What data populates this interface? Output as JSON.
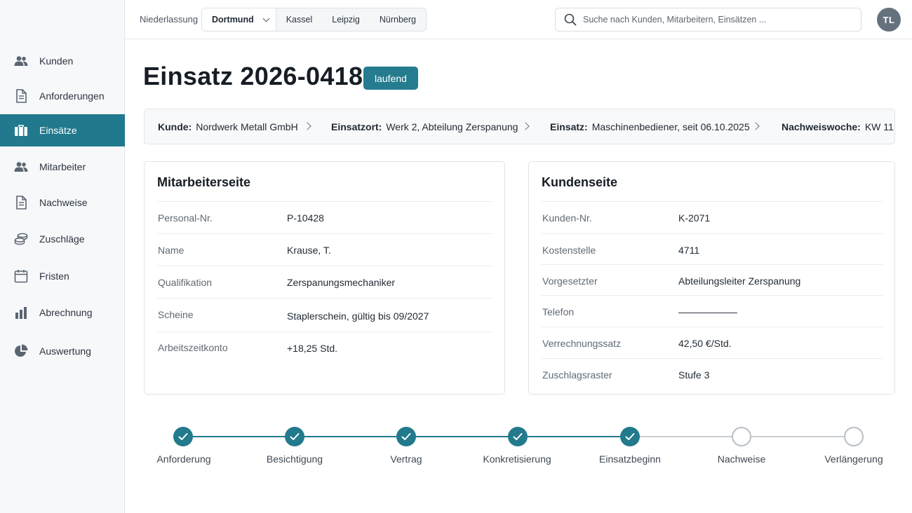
{
  "topbar": {
    "branch_label": "Niederlassung",
    "branches": [
      "Dortmund",
      "Kassel",
      "Leipzig",
      "Nürnberg"
    ],
    "search_placeholder": "Suche nach Kunden, Mitarbeitern, Einsätzen ...",
    "avatar_initials": "TL"
  },
  "sidebar": {
    "items": [
      {
        "label": "Kunden",
        "icon": "users-icon"
      },
      {
        "label": "Anforderungen",
        "icon": "document-icon"
      },
      {
        "label": "Einsätze",
        "icon": "briefcase-icon",
        "active": true
      },
      {
        "label": "Mitarbeiter",
        "icon": "users-icon"
      },
      {
        "label": "Nachweise",
        "icon": "document-icon"
      },
      {
        "label": "Zuschläge",
        "icon": "coins-icon"
      },
      {
        "label": "Fristen",
        "icon": "calendar-icon"
      },
      {
        "label": "Abrechnung",
        "icon": "bar-chart-icon"
      },
      {
        "label": "Auswertung",
        "icon": "pie-chart-icon"
      }
    ]
  },
  "page": {
    "title": "Einsatz 2026-0418",
    "status": "laufend"
  },
  "breadcrumb": [
    {
      "key": "Kunde:",
      "value": "Nordwerk Metall GmbH"
    },
    {
      "key": "Einsatzort:",
      "value": "Werk 2, Abteilung Zerspanung"
    },
    {
      "key": "Einsatz:",
      "value": "Maschinenbediener, seit 06.10.2025"
    },
    {
      "key": "Nachweiswoche:",
      "value": "KW 11"
    }
  ],
  "employee_card": {
    "title": "Mitarbeiterseite",
    "rows": [
      {
        "key": "Personal-Nr.",
        "value": "P-10428"
      },
      {
        "key": "Name",
        "value": "Krause, T."
      },
      {
        "key": "Qualifikation",
        "value": "Zerspanungsmechaniker"
      },
      {
        "key": "Scheine",
        "value": "Staplerschein, gültig bis 09/2027"
      },
      {
        "key": "Arbeitszeitkonto",
        "value": "+18,25 Std."
      }
    ]
  },
  "customer_card": {
    "title": "Kundenseite",
    "rows": [
      {
        "key": "Kunden-Nr.",
        "value": "K-2071"
      },
      {
        "key": "Kostenstelle",
        "value": "4711"
      },
      {
        "key": "Vorgesetzter",
        "value": "Abteilungsleiter Zerspanung"
      },
      {
        "key": "Telefon",
        "value": "——————"
      },
      {
        "key": "Verrechnungssatz",
        "value": "42,50 €/Std."
      },
      {
        "key": "Zuschlagsraster",
        "value": "Stufe 3"
      }
    ]
  },
  "progress": {
    "steps": [
      {
        "label": "Anforderung",
        "done": true
      },
      {
        "label": "Besichtigung",
        "done": true
      },
      {
        "label": "Vertrag",
        "done": true
      },
      {
        "label": "Konkretisierung",
        "done": true
      },
      {
        "label": "Einsatzbeginn",
        "done": true
      },
      {
        "label": "Nachweise",
        "done": false
      },
      {
        "label": "Verlängerung",
        "done": false
      }
    ]
  },
  "colors": {
    "accent": "#20798d",
    "step_todo": "#b8bec4"
  }
}
